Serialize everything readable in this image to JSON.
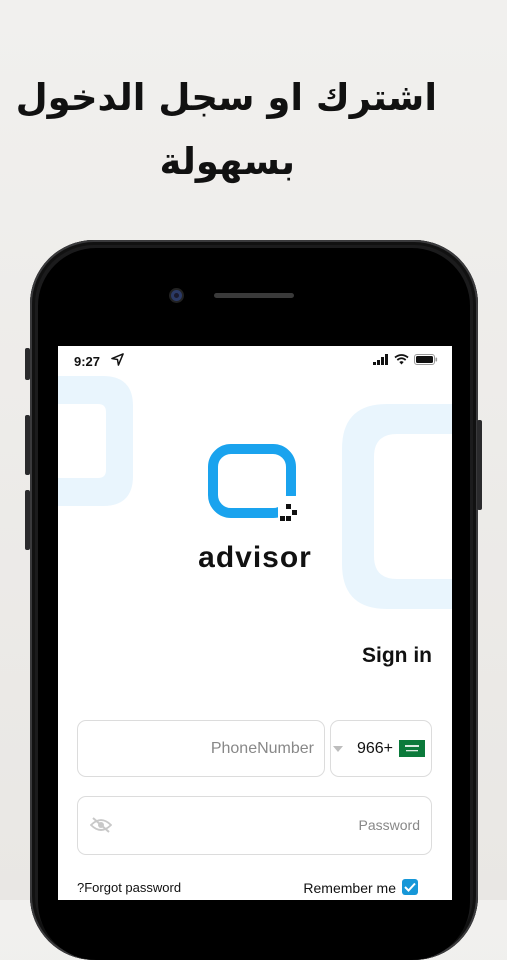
{
  "promo": {
    "line1": "اشترك او سجل الدخول",
    "line2": "بسهولة"
  },
  "status_bar": {
    "time": "9:27"
  },
  "brand": {
    "name": "advisor",
    "logo_color": "#1aa3ee"
  },
  "signin": {
    "title": "Sign in",
    "phone_placeholder": "PhoneNumber",
    "country_code": "966+",
    "password_placeholder": "Password",
    "forgot_label": "?Forgot password",
    "remember_label": "Remember me",
    "remember_checked": true
  },
  "colors": {
    "accent": "#1697d8",
    "deco": "#e6f4fd"
  },
  "icons": [
    "navigation-icon",
    "signal-icon",
    "wifi-icon",
    "battery-icon",
    "dropdown-icon",
    "saudi-flag-icon",
    "eye-off-icon",
    "check-icon"
  ]
}
